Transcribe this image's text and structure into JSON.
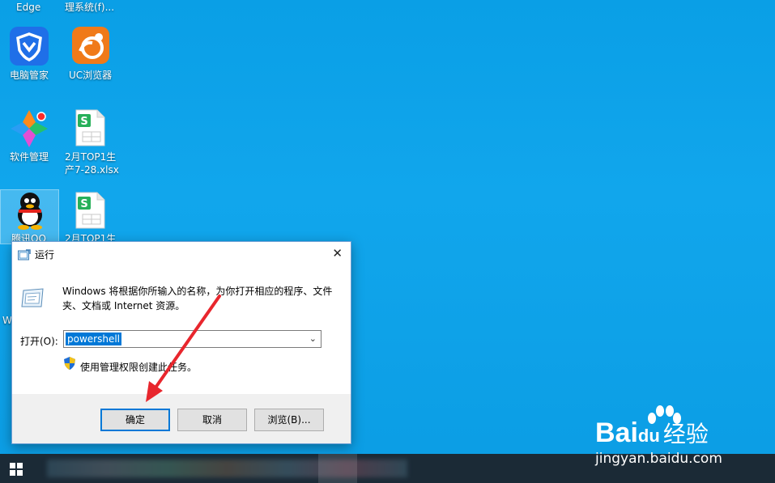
{
  "desktop": {
    "icons": [
      {
        "label": "Edge"
      },
      {
        "label": "理系统(f)..."
      },
      {
        "label": "电脑管家"
      },
      {
        "label": "UC浏览器"
      },
      {
        "label": "软件管理"
      },
      {
        "label": "2月TOP1生产7-28.xlsx"
      },
      {
        "label": "腾讯QQ"
      },
      {
        "label": "2月TOP1生"
      }
    ],
    "partial_left": "W"
  },
  "dialog": {
    "title": "运行",
    "close": "✕",
    "description": "Windows 将根据你所输入的名称，为你打开相应的程序、文件夹、文档或 Internet 资源。",
    "open_label": "打开(O):",
    "input_value": "powershell",
    "admin_note": "使用管理权限创建此任务。",
    "ok": "确定",
    "cancel": "取消",
    "browse": "浏览(B)..."
  },
  "watermark": {
    "brand": "Bai",
    "brand2": "du",
    "brand_cn": "经验",
    "url": "jingyan.baidu.com"
  },
  "colors": {
    "accent": "#0078d7",
    "arrow": "#e8262d"
  }
}
